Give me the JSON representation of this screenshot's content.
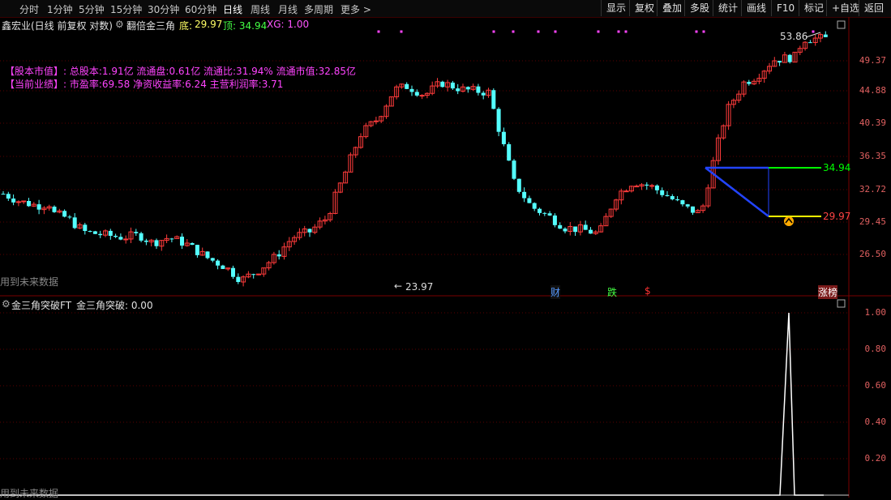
{
  "toolbar": {
    "periods": [
      "分时",
      "1分钟",
      "5分钟",
      "15分钟",
      "30分钟",
      "60分钟",
      "日线",
      "周线",
      "月线",
      "多周期",
      "更多 >"
    ],
    "active_period": "日线",
    "tools": [
      "显示",
      "复权",
      "叠加",
      "多股",
      "统计",
      "画线",
      "F10",
      "标记",
      "+自选",
      "返回"
    ]
  },
  "main": {
    "stock_title": "鑫宏业(日线 前复权 对数)",
    "indicator_name": "翻倍金三角",
    "bottom_label": "底:",
    "bottom_value": "29.97",
    "top_label": "顶: 34.94",
    "xg_label": "XG: 1.00",
    "info_line1": "【股本市值】: 总股本:1.91亿 流通盘:0.61亿 流通比:31.94% 流通市值:32.85亿",
    "info_line2": "【当前业绩】: 市盈率:69.58 净资收益率:6.24 主营利润率:3.71",
    "future_note": "用到未来数据",
    "high_marker": "53.86",
    "low_marker": "23.97",
    "line_top_value": "34.94",
    "line_bottom_value": "29.97",
    "axis_labels": [
      "49.37",
      "44.88",
      "40.39",
      "36.35",
      "32.72",
      "29.45",
      "26.50"
    ],
    "event_labels": {
      "cai": "财",
      "die": "跌",
      "dollar": "$",
      "zhangbang": "涨榜"
    }
  },
  "sub": {
    "title_name": "金三角突破FT",
    "title_value": "金三角突破: 0.00",
    "future_note": "用到未来数据",
    "axis_labels": [
      "1.00",
      "0.80",
      "0.60",
      "0.40",
      "0.20"
    ]
  },
  "colors": {
    "up": "#ff3b3b",
    "down": "#54ffff",
    "purple": "#ff44ff",
    "green": "#00ff00",
    "yellow": "#ffff00",
    "blue": "#2244ff",
    "grid": "#5a0000"
  },
  "chart_data": {
    "type": "candlestick",
    "ylim": [
      23.97,
      53.86
    ],
    "scale": "log",
    "markers": {
      "high": 53.86,
      "low": 23.97,
      "top_line": 34.94,
      "bottom_line": 29.97
    },
    "sub_series": {
      "name": "金三角突破",
      "ylim": [
        0,
        1.0
      ],
      "peak": 1.0
    }
  }
}
